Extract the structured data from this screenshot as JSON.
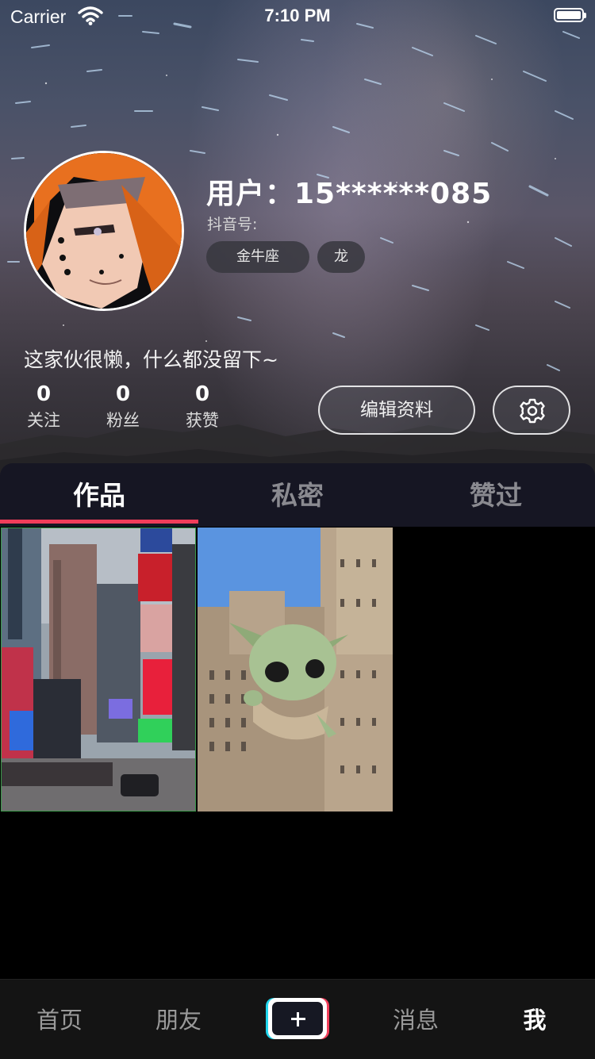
{
  "status_bar": {
    "carrier": "Carrier",
    "time": "7:10 PM"
  },
  "profile": {
    "username": "用户：15******085",
    "douyin_id_label": "抖音号:",
    "tags": [
      "金牛座",
      "龙"
    ],
    "bio": "这家伙很懒，什么都没留下~",
    "stats": [
      {
        "value": "0",
        "label": "关注"
      },
      {
        "value": "0",
        "label": "粉丝"
      },
      {
        "value": "0",
        "label": "获赞"
      }
    ],
    "edit_button": "编辑资料"
  },
  "tabs": [
    "作品",
    "私密",
    "赞过"
  ],
  "active_tab": "作品",
  "bottom_nav": {
    "home": "首页",
    "friends": "朋友",
    "messages": "消息",
    "me": "我"
  },
  "colors": {
    "accent": "#f03d5a",
    "tab_bg": "#161623",
    "plus_cyan": "#20d5ec",
    "plus_red": "#f23f5a"
  },
  "icons": {
    "wifi": "wifi-icon",
    "battery": "battery-icon",
    "settings": "gear-icon",
    "create": "plus-icon"
  }
}
